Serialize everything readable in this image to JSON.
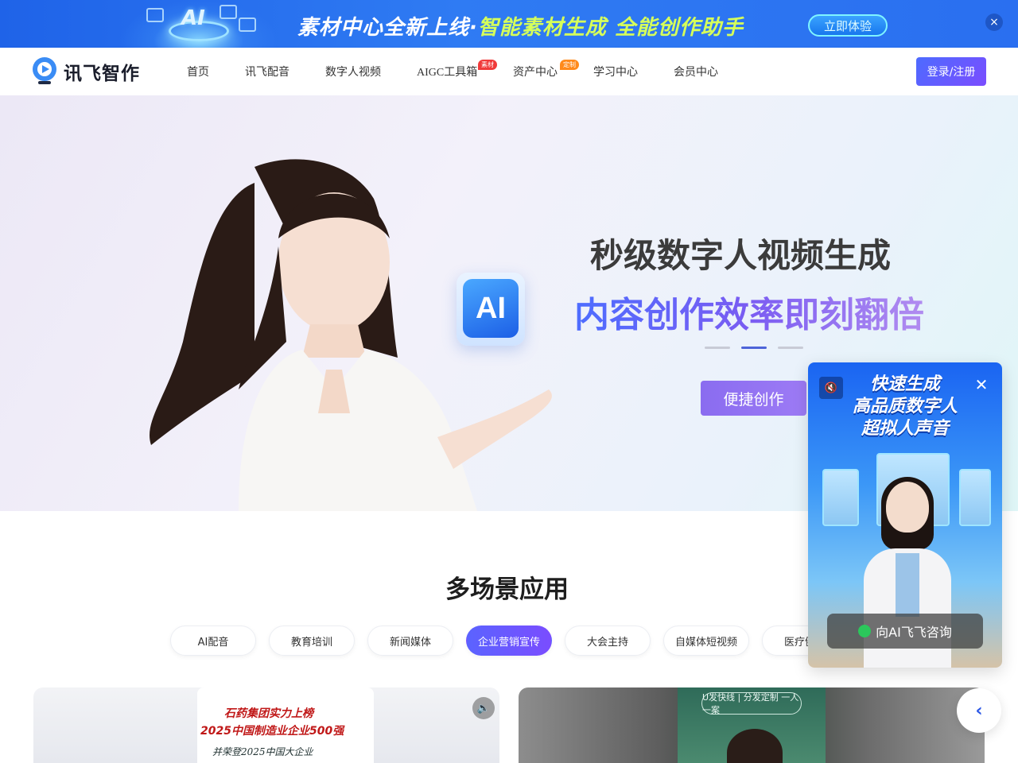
{
  "promo": {
    "title_part1": "素材中心全新上线·",
    "title_part2": "智能素材生成 全能创作助手",
    "art_text": "AI",
    "cta": "立即体验",
    "close_glyph": "×"
  },
  "nav": {
    "logo_text": "讯飞智作",
    "items": [
      {
        "label": "首页"
      },
      {
        "label": "讯飞配音"
      },
      {
        "label": "数字人视频"
      },
      {
        "label": "AIGC工具箱",
        "badge": "素材"
      },
      {
        "label": "资产中心",
        "badge": "定制"
      },
      {
        "label": "学习中心"
      },
      {
        "label": "会员中心"
      }
    ],
    "login": "登录/注册"
  },
  "hero": {
    "title": "秒级数字人视频生成",
    "subtitle": "内容创作效率即刻翻倍",
    "cube_text": "AI",
    "cta": "便捷创作",
    "carousel_active_index": 1,
    "carousel_count": 3
  },
  "scenes": {
    "title": "多场景应用",
    "tabs": [
      "AI配音",
      "教育培训",
      "新闻媒体",
      "企业营销宣传",
      "大会主持",
      "自媒体短视频",
      "医疗健康"
    ],
    "active_tab": "企业营销宣传"
  },
  "cards": {
    "left": {
      "line1": "石药集团实力上榜",
      "line2": "2025中国制造业企业500强",
      "line3": "并荣登2025中国大企业"
    },
    "right": {
      "sign_text": "U发快线 | 分发定制 一人一案"
    }
  },
  "float_panel": {
    "headline_1": "快速生成",
    "headline_2": "高品质数字人",
    "headline_3": "超拟人声音",
    "consult": "向AI飞飞咨询",
    "close_glyph": "✕",
    "mute_glyph": "🔇"
  },
  "side": {
    "arrow_glyph": "‹"
  },
  "colors": {
    "primary": "#4d64d8",
    "accent_purple": "#7b4dff",
    "promo_blue": "#2a6ff0",
    "badge_red": "#f03a3a",
    "badge_orange": "#ff8a1c"
  }
}
